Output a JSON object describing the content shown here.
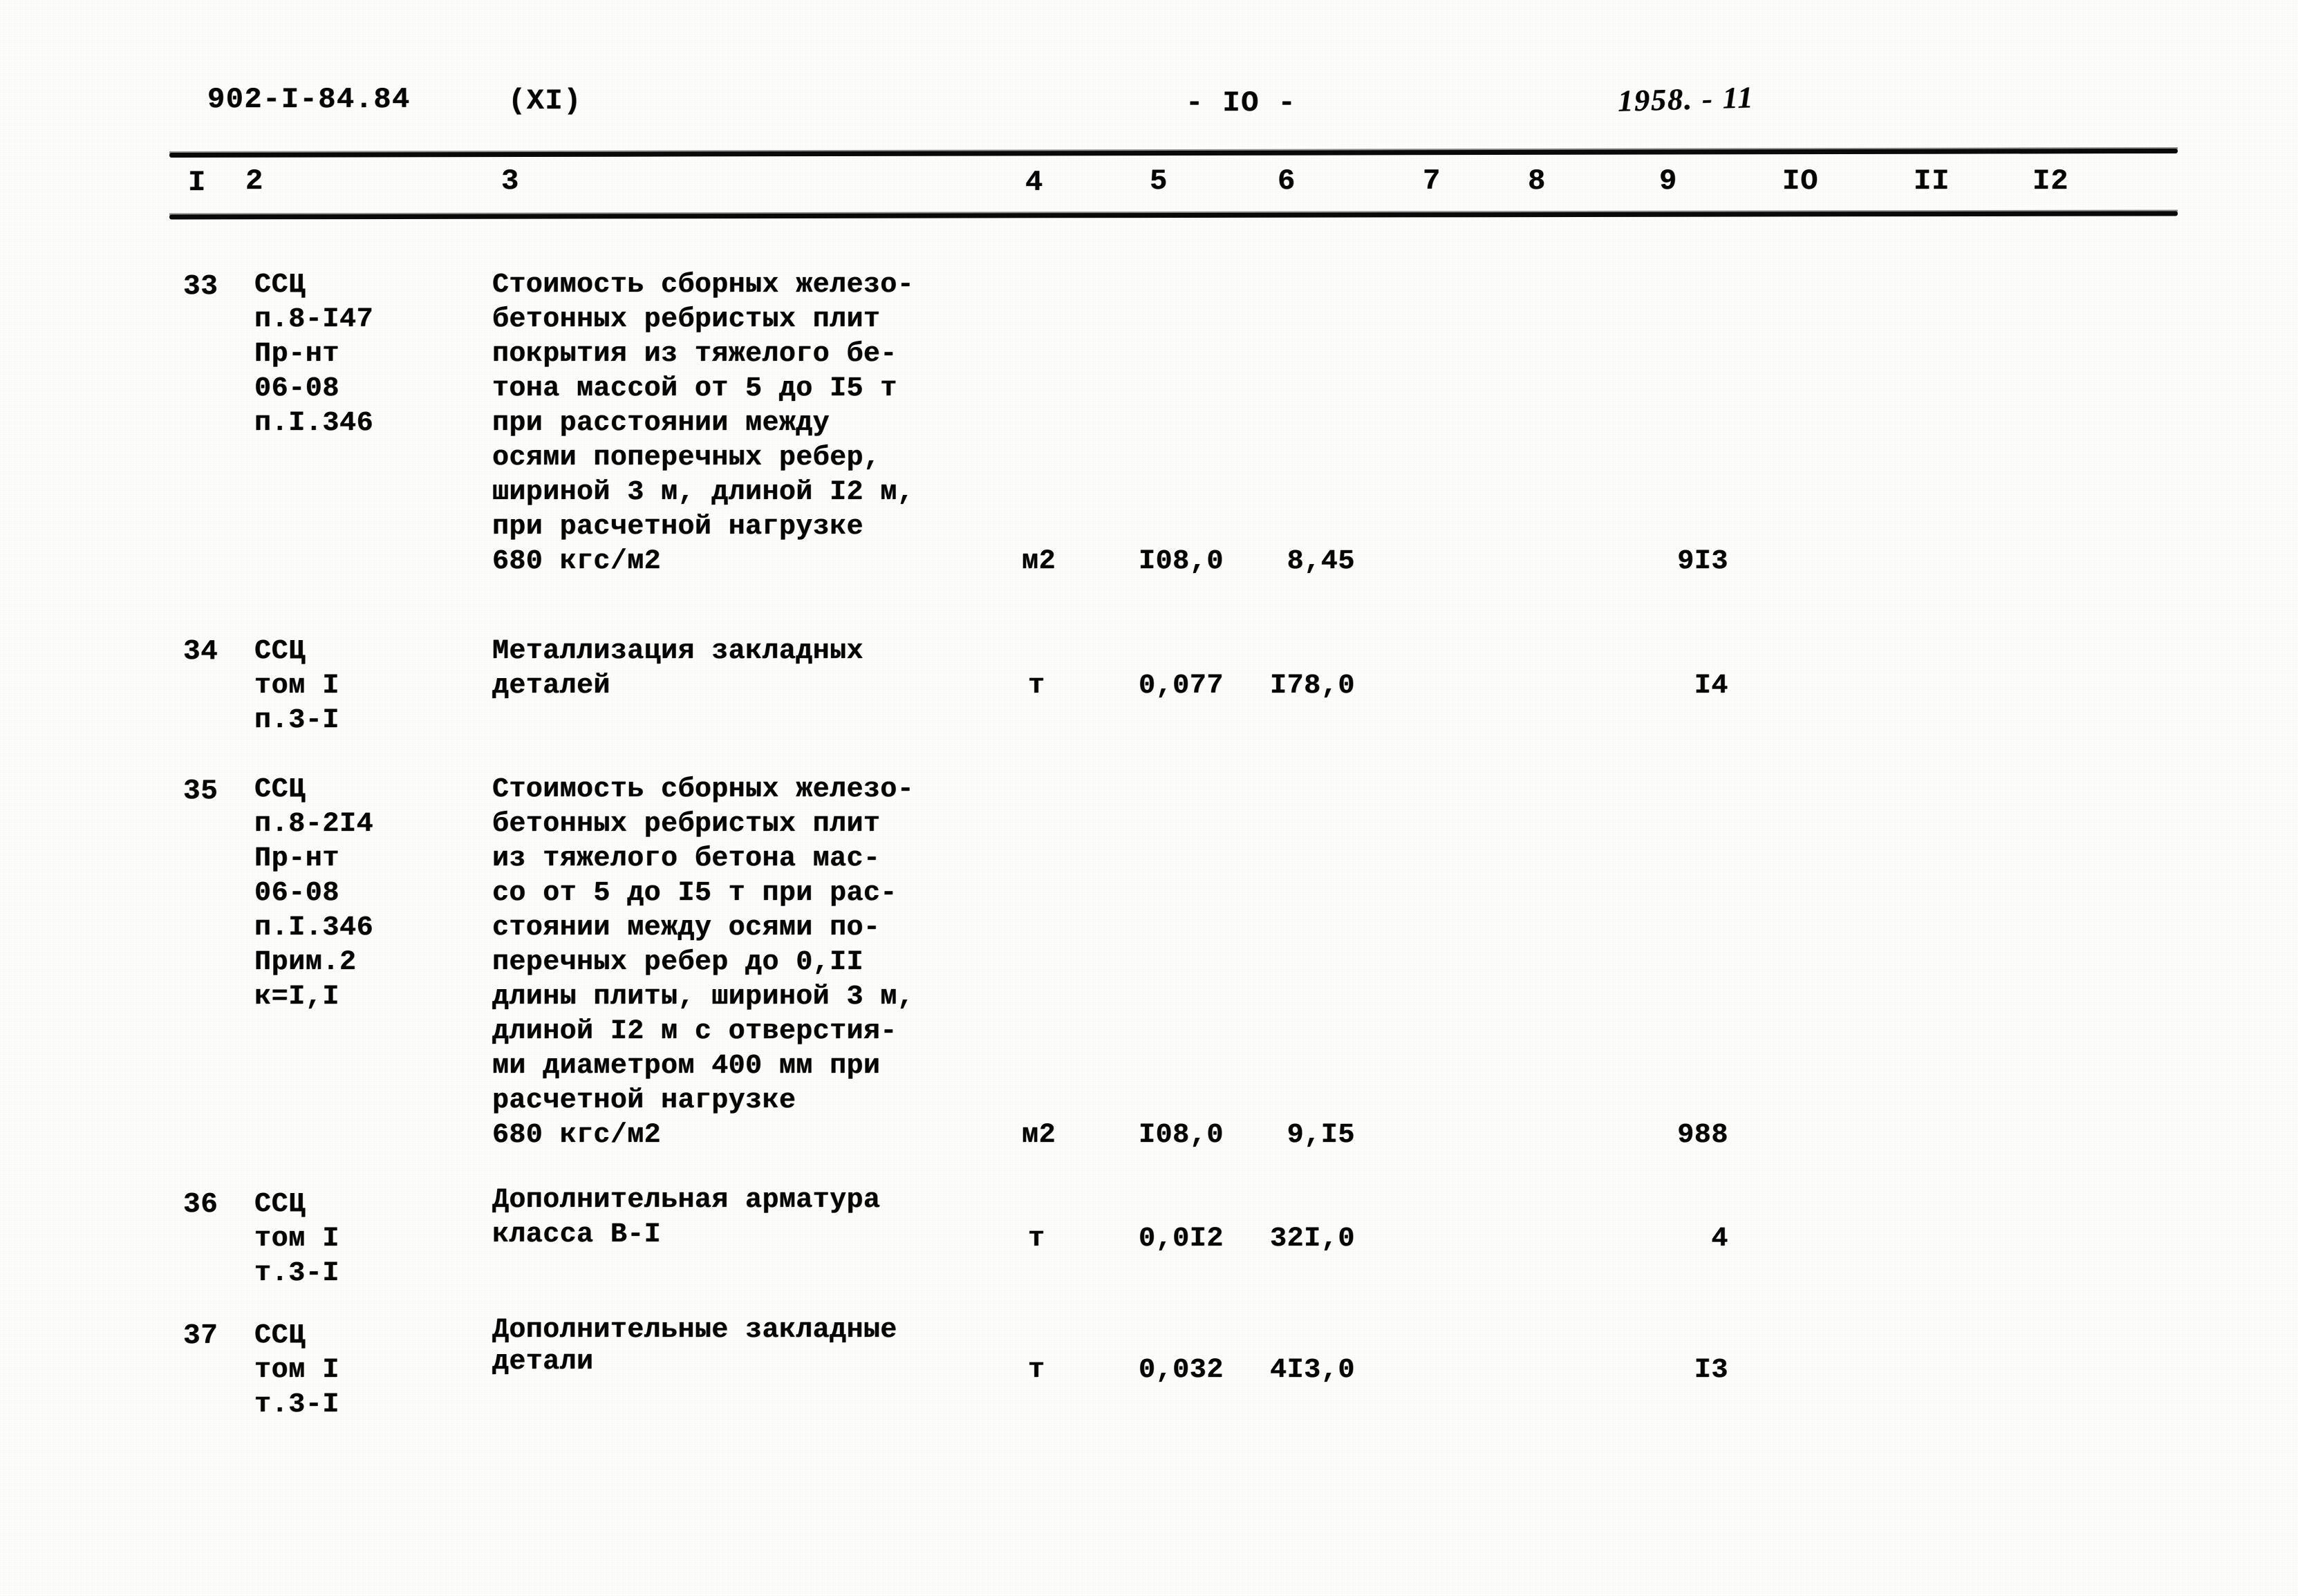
{
  "header": {
    "doc_code": "902-I-84.84",
    "volume": "(XI)",
    "page_number": "- IO -",
    "handwritten_note": "1958. - 11"
  },
  "table": {
    "column_headers": [
      "I",
      "2",
      "3",
      "4",
      "5",
      "6",
      "7",
      "8",
      "9",
      "IO",
      "II",
      "I2"
    ],
    "rows": [
      {
        "no": "33",
        "ref": [
          "ССЦ",
          "п.8-I47",
          "Пр-нт",
          "06-08",
          "п.I.346"
        ],
        "description": [
          "Стоимость сборных железо-",
          "бетонных ребристых плит",
          "покрытия из тяжелого бе-",
          "тона массой от 5 до I5 т",
          "при расстоянии между",
          "осями поперечных ребер,",
          "шириной 3 м, длиной I2 м,",
          "при расчетной нагрузке",
          "680 кгс/м2"
        ],
        "unit": "м2",
        "col5": "I08,0",
        "col6": "8,45",
        "col7": "",
        "col8": "",
        "col9": "9I3",
        "col10": "",
        "col11": "",
        "col12": ""
      },
      {
        "no": "34",
        "ref": [
          "ССЦ",
          "том I",
          "п.3-I"
        ],
        "description": [
          "Металлизация закладных",
          "деталей"
        ],
        "unit": "т",
        "col5": "0,077",
        "col6": "I78,0",
        "col7": "",
        "col8": "",
        "col9": "I4",
        "col10": "",
        "col11": "",
        "col12": ""
      },
      {
        "no": "35",
        "ref": [
          "ССЦ",
          "п.8-2I4",
          "Пр-нт",
          "06-08",
          "п.I.346",
          "Прим.2",
          "к=I,I"
        ],
        "description": [
          "Стоимость сборных железо-",
          "бетонных ребристых плит",
          "из тяжелого бетона мас-",
          "со от 5 до I5 т при рас-",
          "стоянии между осями по-",
          "перечных ребер до 0,II",
          "длины плиты, шириной 3 м,",
          "длиной I2 м с отверстия-",
          "ми диаметром 400 мм при",
          "расчетной нагрузке",
          "680 кгс/м2"
        ],
        "unit": "м2",
        "col5": "I08,0",
        "col6": "9,I5",
        "col7": "",
        "col8": "",
        "col9": "988",
        "col10": "",
        "col11": "",
        "col12": ""
      },
      {
        "no": "36",
        "ref": [
          "ССЦ",
          "том I",
          "т.3-I"
        ],
        "description": [
          "Дополнительная арматура",
          "класса В-I"
        ],
        "unit": "т",
        "col5": "0,0I2",
        "col6": "32I,0",
        "col7": "",
        "col8": "",
        "col9": "4",
        "col10": "",
        "col11": "",
        "col12": ""
      },
      {
        "no": "37",
        "ref": [
          "ССЦ",
          "том I",
          "т.3-I"
        ],
        "description": [
          "Дополнительные закладные",
          "детали"
        ],
        "unit": "т",
        "col5": "0,032",
        "col6": "4I3,0",
        "col7": "",
        "col8": "",
        "col9": "I3",
        "col10": "",
        "col11": "",
        "col12": ""
      }
    ]
  }
}
